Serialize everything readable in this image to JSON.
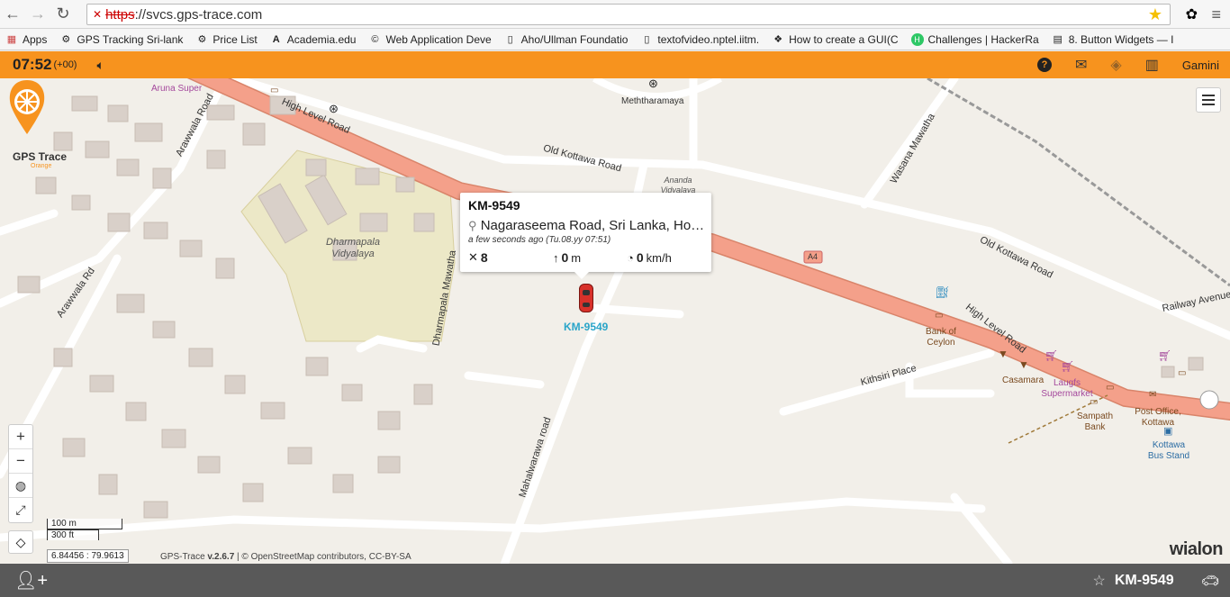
{
  "browser": {
    "url_scheme": "https",
    "url_rest": "://svcs.gps-trace.com",
    "bookmarks": [
      {
        "label": "Apps",
        "icon": "apps-grid-icon"
      },
      {
        "label": "GPS Tracking Sri-lank",
        "icon": "site-favicon-icon"
      },
      {
        "label": "Price List",
        "icon": "site-favicon-icon"
      },
      {
        "label": "Academia.edu",
        "icon": "academia-icon"
      },
      {
        "label": "Web Application Deve",
        "icon": "site-favicon-icon"
      },
      {
        "label": "Aho/Ullman Foundatio",
        "icon": "page-icon"
      },
      {
        "label": "textofvideo.nptel.iitm.",
        "icon": "page-icon"
      },
      {
        "label": "How to create a GUI(C",
        "icon": "site-favicon-icon"
      },
      {
        "label": "Challenges | HackerRa",
        "icon": "hackerrank-icon"
      },
      {
        "label": "8. Button Widgets — I",
        "icon": "site-favicon-icon"
      }
    ]
  },
  "header": {
    "time": "07:52",
    "tz": "(+00)",
    "user": "Gamini"
  },
  "map": {
    "labels": {
      "high_level_road": "High Level Road",
      "old_kottawa_1": "Old Kottawa Road",
      "old_kottawa_2": "Old Kottawa Road",
      "arawwala_road": "Arawwala Road",
      "arawwala_rd": "Arawwala Rd",
      "dharmapala_mawatha": "Dharmapala Mawatha",
      "mahalwarawa_road": "Mahalwarawa road",
      "wasana_mawatha": "Wasana Mawatha",
      "kithsiri_place": "Kithsiri Place",
      "railway_avenue": "Railway Avenue",
      "high_level_road_2": "High Level Road",
      "a4": "A4",
      "dharmapala_vidyalaya": "Dharmapala Vidyalaya",
      "meththaramaya": "Meththaramaya",
      "ananda_vidyalaya": "Ananda Vidyalaya",
      "aruna_super": "Aruna Super",
      "bank_of_ceylon": "Bank of Ceylon",
      "casamara": "Casamara",
      "laugfs": "Laugfs Supermarket",
      "sampath": "Sampath Bank",
      "post_office": "Post Office, Kottawa",
      "kottawa_bus": "Kottawa Bus Stand"
    },
    "logo_text": "GPS Trace",
    "logo_sub": "Orange",
    "scale_m": "100 m",
    "scale_ft": "300 ft",
    "coords": "6.84456 : 79.9613",
    "attribution_prefix": "GPS-Trace ",
    "attribution_version": "v.2.6.7",
    "attribution_rest": " | © OpenStreetMap contributors, CC-BY-SA",
    "brand": "wialon"
  },
  "popup": {
    "unit": "KM-9549",
    "address": "Nagaraseema Road, Sri Lanka, Ho…",
    "time": "a few seconds ago (Tu.08.yy 07:51)",
    "satellites": "8",
    "altitude": "0",
    "altitude_unit": "m",
    "speed": "0",
    "speed_unit": "km/h"
  },
  "car_label": "KM-9549",
  "bottom": {
    "unit_name": "KM-9549"
  },
  "colors": {
    "header_bg": "#f7931e",
    "main_road": "#f4a08a",
    "bottom_bar": "#595959",
    "car": "#d8312a",
    "car_label": "#2aa5c9"
  }
}
